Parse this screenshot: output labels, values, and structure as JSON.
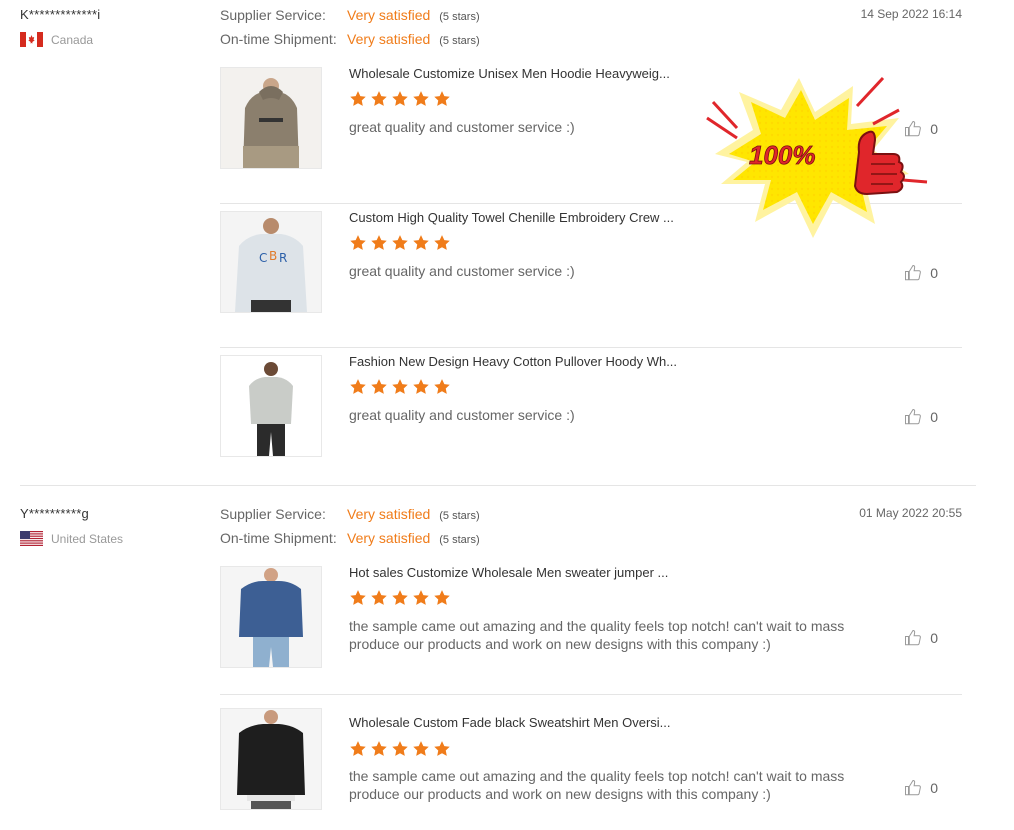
{
  "reviews": [
    {
      "buyer": {
        "name": "K*************i",
        "country": "Canada"
      },
      "ratings": [
        {
          "label": "Supplier Service:",
          "value": "Very satisfied",
          "stars": "(5 stars)"
        },
        {
          "label": "On-time Shipment:",
          "value": "Very satisfied",
          "stars": "(5 stars)"
        }
      ],
      "date": "14 Sep 2022 16:14",
      "products": [
        {
          "title": "Wholesale Customize Unisex Men Hoodie Heavyweig...",
          "rating": 5,
          "text": "great quality and customer service :)",
          "likes": "0"
        },
        {
          "title": "Custom High Quality Towel Chenille Embroidery Crew ...",
          "rating": 5,
          "text": "great quality and customer service :)",
          "likes": "0"
        },
        {
          "title": "Fashion New Design Heavy Cotton Pullover Hoody Wh...",
          "rating": 5,
          "text": "great quality and customer service :)",
          "likes": "0"
        }
      ]
    },
    {
      "buyer": {
        "name": "Y**********g",
        "country": "United States"
      },
      "ratings": [
        {
          "label": "Supplier Service:",
          "value": "Very satisfied",
          "stars": "(5 stars)"
        },
        {
          "label": "On-time Shipment:",
          "value": "Very satisfied",
          "stars": "(5 stars)"
        }
      ],
      "date": "01 May 2022 20:55",
      "products": [
        {
          "title": "Hot sales Customize Wholesale Men sweater jumper ...",
          "rating": 5,
          "text": "the sample came out amazing and the quality feels top notch! can't wait to mass produce our products and work on new designs with this company :)",
          "likes": "0"
        },
        {
          "title": "Wholesale Custom Fade black Sweatshirt Men Oversi...",
          "rating": 5,
          "text": "the sample came out amazing and the quality feels top notch! can't wait to mass produce our products and work on new designs with this company :)",
          "likes": "0"
        }
      ]
    }
  ],
  "badge": {
    "text": "100%",
    "icon": "thumbs-up-icon"
  },
  "colors": {
    "accent": "#f07c1a",
    "star": "#f07c1a",
    "badge_yellow": "#ffe600",
    "badge_red": "#e0262b"
  }
}
